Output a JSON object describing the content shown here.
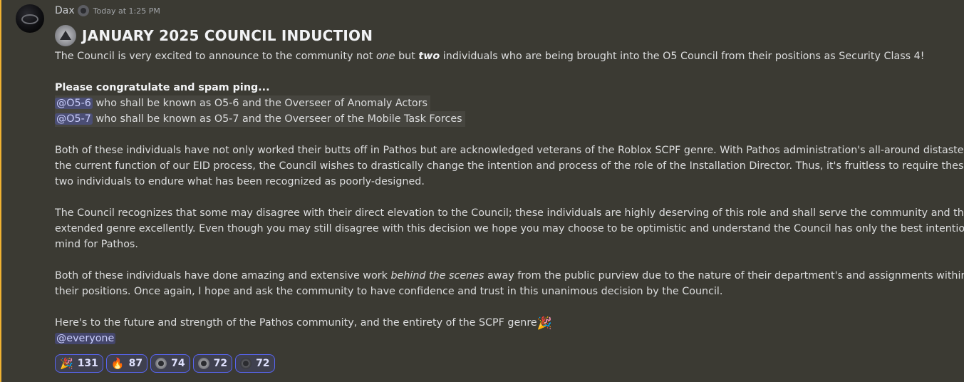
{
  "author": {
    "username": "Dax",
    "timestamp": "Today at 1:25 PM"
  },
  "message": {
    "title": "JANUARY 2025 COUNCIL INDUCTION",
    "intro": {
      "a": "The Council is very excited to announce to the community not ",
      "b": "one",
      "c": " but ",
      "d": "two",
      "e": " individuals who are being brought into the O5 Council from their positions as Security Class 4!"
    },
    "congrats": "Please congratulate and spam ping...",
    "mentions": [
      {
        "role": "@O5-6",
        "text": " who shall be known as O5-6 and the Overseer of Anomaly Actors"
      },
      {
        "role": "@O5-7",
        "text": " who shall be known as O5-7 and the Overseer of the Mobile Task Forces"
      }
    ],
    "para1": [
      "Both of these individuals have not only worked their butts off in Pathos but are acknowledged veterans of the Roblox SCPF genre. With Pathos administration's all-around distaste of",
      "the current function of our EID process, the Council wishes to drastically change the intention and process of the role of the Installation Director. Thus, it's fruitless to require these",
      "two individuals to endure what has been recognized as poorly-designed."
    ],
    "para2": [
      "The Council recognizes that some may disagree with their direct elevation to the Council; these individuals are highly deserving of this role and shall serve the community and the",
      "extended genre excellently. Even though you may still disagree with this decision we hope you may choose to be optimistic and understand the Council has only the best intentions in",
      "mind for Pathos."
    ],
    "para3": {
      "l1a": "Both of these individuals have done amazing and extensive work ",
      "l1b": "behind the scenes",
      "l1c": " away from the public purview due to the nature of their department's and assignments within",
      "l2": "their positions. Once again, I hope and ask the community to have confidence and trust in this unanimous decision by the Council."
    },
    "closing": "Here's to the future and strength of the Pathos community, and the entirety of the SCPF genre",
    "closing_emoji": "🎉",
    "everyone": "@everyone"
  },
  "reactions": [
    {
      "emoji": "🎉",
      "icon": "party-popper-icon",
      "count": "131"
    },
    {
      "emoji": "🔥",
      "icon": "fire-icon",
      "count": "87"
    },
    {
      "emoji": "",
      "icon": "council-seal-icon",
      "count": "74"
    },
    {
      "emoji": "",
      "icon": "scp-seal-icon",
      "count": "72"
    },
    {
      "emoji": "",
      "icon": "council-seal-dark-icon",
      "count": "72"
    }
  ]
}
